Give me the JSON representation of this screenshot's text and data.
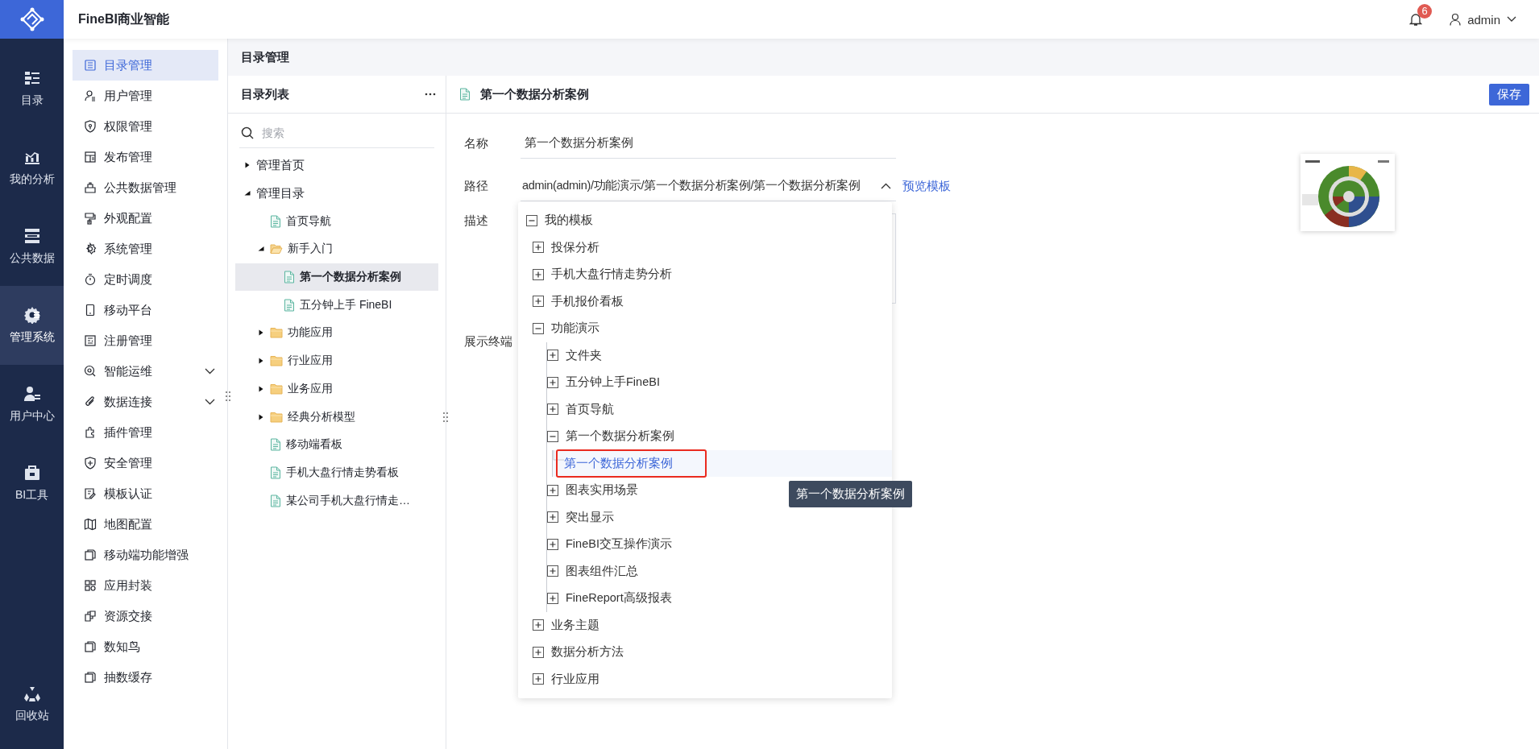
{
  "app": {
    "title": "FineBI商业智能"
  },
  "header": {
    "notifications": "6",
    "user": "admin"
  },
  "rail": {
    "items": [
      {
        "label": "目录",
        "selected": false
      },
      {
        "label": "我的分析",
        "selected": false
      },
      {
        "label": "公共数据",
        "selected": false
      },
      {
        "label": "管理系统",
        "selected": true
      },
      {
        "label": "用户中心",
        "selected": false
      },
      {
        "label": "BI工具",
        "selected": false
      }
    ],
    "bottom": {
      "label": "回收站"
    }
  },
  "menu": {
    "items": [
      {
        "label": "目录管理",
        "selected": true,
        "expandable": false
      },
      {
        "label": "用户管理",
        "selected": false,
        "expandable": false
      },
      {
        "label": "权限管理",
        "selected": false,
        "expandable": false
      },
      {
        "label": "发布管理",
        "selected": false,
        "expandable": false
      },
      {
        "label": "公共数据管理",
        "selected": false,
        "expandable": false
      },
      {
        "label": "外观配置",
        "selected": false,
        "expandable": false
      },
      {
        "label": "系统管理",
        "selected": false,
        "expandable": false
      },
      {
        "label": "定时调度",
        "selected": false,
        "expandable": false
      },
      {
        "label": "移动平台",
        "selected": false,
        "expandable": false
      },
      {
        "label": "注册管理",
        "selected": false,
        "expandable": false
      },
      {
        "label": "智能运维",
        "selected": false,
        "expandable": true
      },
      {
        "label": "数据连接",
        "selected": false,
        "expandable": true
      },
      {
        "label": "插件管理",
        "selected": false,
        "expandable": false
      },
      {
        "label": "安全管理",
        "selected": false,
        "expandable": false
      },
      {
        "label": "模板认证",
        "selected": false,
        "expandable": false
      },
      {
        "label": "地图配置",
        "selected": false,
        "expandable": false
      },
      {
        "label": "移动端功能增强",
        "selected": false,
        "expandable": false
      },
      {
        "label": "应用封装",
        "selected": false,
        "expandable": false
      },
      {
        "label": "资源交接",
        "selected": false,
        "expandable": false
      },
      {
        "label": "数知鸟",
        "selected": false,
        "expandable": false
      },
      {
        "label": "抽数缓存",
        "selected": false,
        "expandable": false
      }
    ]
  },
  "breadcrumb": "目录管理",
  "catalog": {
    "title": "目录列表",
    "search": {
      "placeholder": "搜索"
    },
    "tree": [
      {
        "label": "管理首页",
        "kind": "group",
        "expanded": false,
        "selected": false
      },
      {
        "label": "管理目录",
        "kind": "group",
        "expanded": true,
        "selected": false,
        "children": [
          {
            "label": "首页导航",
            "kind": "file",
            "selected": false
          },
          {
            "label": "新手入门",
            "kind": "folder",
            "expanded": true,
            "selected": false,
            "children": [
              {
                "label": "第一个数据分析案例",
                "kind": "file",
                "selected": true
              },
              {
                "label": "五分钟上手 FineBI",
                "kind": "file",
                "selected": false
              }
            ]
          },
          {
            "label": "功能应用",
            "kind": "folder",
            "expanded": false,
            "selected": false
          },
          {
            "label": "行业应用",
            "kind": "folder",
            "expanded": false,
            "selected": false
          },
          {
            "label": "业务应用",
            "kind": "folder",
            "expanded": false,
            "selected": false
          },
          {
            "label": "经典分析模型",
            "kind": "folder",
            "expanded": false,
            "selected": false
          },
          {
            "label": "移动端看板",
            "kind": "file",
            "selected": false
          },
          {
            "label": "手机大盘行情走势看板",
            "kind": "file",
            "selected": false
          },
          {
            "label": "某公司手机大盘行情走…",
            "kind": "file",
            "selected": false
          }
        ]
      }
    ]
  },
  "detail": {
    "title": "第一个数据分析案例",
    "save": "保存",
    "fields": [
      {
        "label": "名称",
        "kind": "text",
        "value": "第一个数据分析案例"
      },
      {
        "label": "路径",
        "kind": "select",
        "value": "admin(admin)/功能演示/第一个数据分析案例/第一个数据分析案例",
        "expanded": true,
        "link": "预览模板"
      },
      {
        "label": "描述",
        "kind": "textarea"
      },
      {
        "label": "展示终端",
        "kind": "blank"
      }
    ],
    "dropdown": [
      {
        "label": "我的模板",
        "expanded": true,
        "selected": false,
        "children": [
          {
            "label": "投保分析",
            "expanded": false,
            "selected": false
          },
          {
            "label": "手机大盘行情走势分析",
            "expanded": false,
            "selected": false
          },
          {
            "label": "手机报价看板",
            "expanded": false,
            "selected": false
          },
          {
            "label": "功能演示",
            "expanded": true,
            "selected": false,
            "children": [
              {
                "label": "文件夹",
                "expanded": false,
                "selected": false
              },
              {
                "label": "五分钟上手FineBI",
                "expanded": false,
                "selected": false
              },
              {
                "label": "首页导航",
                "expanded": false,
                "selected": false
              },
              {
                "label": "第一个数据分析案例",
                "expanded": true,
                "selected": false,
                "children": [
                  {
                    "label": "第一个数据分析案例",
                    "kind": "leaf",
                    "selected": true,
                    "marked": true
                  }
                ]
              },
              {
                "label": "图表实用场景",
                "expanded": false,
                "selected": false
              },
              {
                "label": "突出显示",
                "expanded": false,
                "selected": false
              },
              {
                "label": "FineBI交互操作演示",
                "expanded": false,
                "selected": false
              },
              {
                "label": "图表组件汇总",
                "expanded": false,
                "selected": false
              },
              {
                "label": "FineReport高级报表",
                "expanded": false,
                "selected": false
              }
            ]
          },
          {
            "label": "业务主题",
            "expanded": false,
            "selected": false
          },
          {
            "label": "数据分析方法",
            "expanded": false,
            "selected": false
          },
          {
            "label": "行业应用",
            "expanded": false,
            "selected": false
          }
        ]
      }
    ],
    "tooltip": "第一个数据分析案例"
  }
}
